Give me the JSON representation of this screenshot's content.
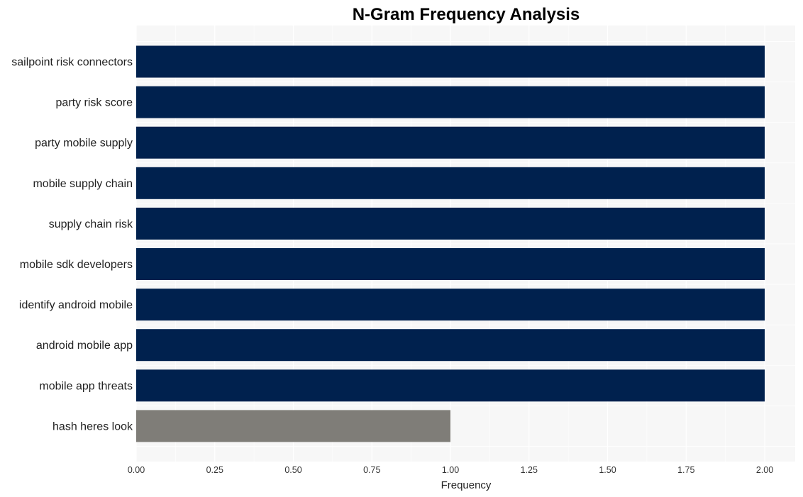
{
  "chart_data": {
    "type": "bar",
    "orientation": "horizontal",
    "title": "N-Gram Frequency Analysis",
    "xlabel": "Frequency",
    "ylabel": "",
    "xlim": [
      0,
      2.1
    ],
    "xticks": [
      0,
      0.25,
      0.5,
      0.75,
      1.0,
      1.25,
      1.5,
      1.75,
      2.0
    ],
    "xtick_labels": [
      "0.00",
      "0.25",
      "0.50",
      "0.75",
      "1.00",
      "1.25",
      "1.50",
      "1.75",
      "2.00"
    ],
    "grid": true,
    "categories": [
      "sailpoint risk connectors",
      "party risk score",
      "party mobile supply",
      "mobile supply chain",
      "supply chain risk",
      "mobile sdk developers",
      "identify android mobile",
      "android mobile app",
      "mobile app threats",
      "hash heres look"
    ],
    "values": [
      2,
      2,
      2,
      2,
      2,
      2,
      2,
      2,
      2,
      1
    ],
    "colors": [
      "#00214e",
      "#00214e",
      "#00214e",
      "#00214e",
      "#00214e",
      "#00214e",
      "#00214e",
      "#00214e",
      "#00214e",
      "#7f7d78"
    ],
    "panel_background": "#f7f7f7",
    "grid_color": "#ffffff"
  }
}
